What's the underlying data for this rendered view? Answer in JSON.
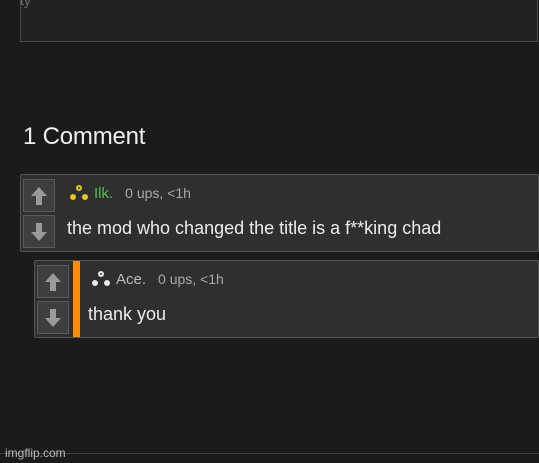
{
  "top_box": {
    "partial_text": "ty"
  },
  "comments_heading": "1 Comment",
  "comments": [
    {
      "username": "Ilk.",
      "username_color": "#4fbf4f",
      "stats": "0 ups, <1h",
      "body": "the mod who changed the title is a f**king chad",
      "upvote_icon": "arrow-up-icon",
      "downvote_icon": "arrow-down-icon",
      "user_icon": "triangle-dots-icon"
    },
    {
      "username": "Ace.",
      "username_color": "#bdbdbd",
      "stats": "0 ups, <1h",
      "body": "thank you",
      "accent_color": "#ff8c00",
      "upvote_icon": "arrow-up-icon",
      "downvote_icon": "arrow-down-icon",
      "user_icon": "triangle-dots-icon"
    }
  ],
  "watermark": "imgflip.com"
}
